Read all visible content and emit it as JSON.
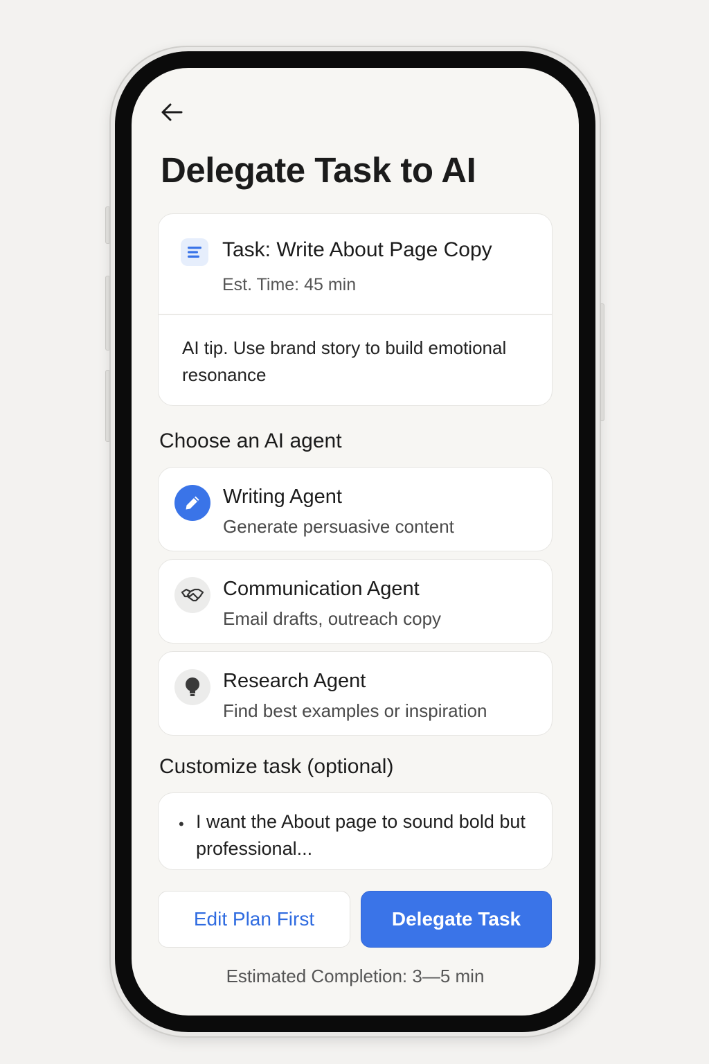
{
  "header": {
    "title": "Delegate Task to AI"
  },
  "task": {
    "title": "Task: Write About Page Copy",
    "estimate": "Est. Time: 45 min",
    "tip": "AI tip. Use brand story to build emotional resonance",
    "icon": "document-lines-icon"
  },
  "agents": {
    "heading": "Choose an AI agent",
    "items": [
      {
        "name": "Writing Agent",
        "description": "Generate persuasive content",
        "icon": "pencil-icon",
        "selected": true
      },
      {
        "name": "Communication Agent",
        "description": "Email drafts, outreach copy",
        "icon": "handshake-icon",
        "selected": false
      },
      {
        "name": "Research Agent",
        "description": "Find best examples  or inspiration",
        "icon": "lightbulb-icon",
        "selected": false
      }
    ]
  },
  "customize": {
    "heading": "Customize task (optional)",
    "bullet": "•",
    "value": "I want the About page to sound bold but professional..."
  },
  "actions": {
    "edit_label": "Edit Plan First",
    "delegate_label": "Delegate Task"
  },
  "footer": {
    "estimated_completion": "Estimated Completion: 3—5 min"
  },
  "colors": {
    "accent": "#3a74e8",
    "background": "#f7f6f3",
    "card": "#ffffff"
  }
}
